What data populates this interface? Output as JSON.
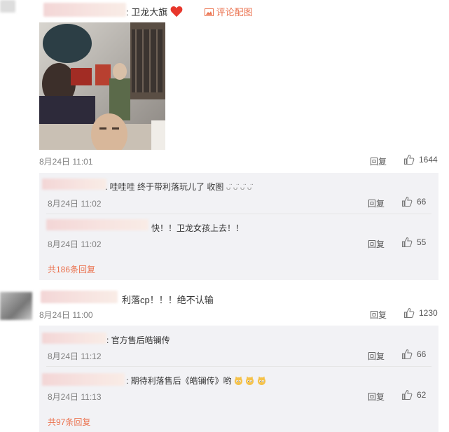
{
  "top_comment": {
    "text_tail": ": 卫龙大旗",
    "comment_pic_label": "评论配图",
    "time": "8月24日 11:01",
    "reply_label": "回复",
    "like_count": "1644"
  },
  "top_replies": [
    {
      "text": "哇哇哇 终于带利落玩儿了 收图",
      "time": "8月24日 11:02",
      "reply_label": "回复",
      "like_count": "66"
    },
    {
      "text": "快！！卫龙女孩上去！！",
      "time": "8月24日 11:02",
      "reply_label": "回复",
      "like_count": "55"
    }
  ],
  "top_more": "共186条回复",
  "second_comment": {
    "text": "利落cp！！！绝不认输",
    "time": "8月24日 11:00",
    "reply_label": "回复",
    "like_count": "1230"
  },
  "second_replies": [
    {
      "text": "官方售后皓镧传",
      "time": "8月24日 11:12",
      "reply_label": "回复",
      "like_count": "66"
    },
    {
      "text": "期待利落售后《皓镧传》哟",
      "time": "8月24日 11:13",
      "reply_label": "回复",
      "like_count": "62"
    }
  ],
  "second_more": "共97条回复",
  "colors": {
    "accent": "#eb7350",
    "sub_bg": "#f2f2f5",
    "heart": "#e8372c"
  }
}
